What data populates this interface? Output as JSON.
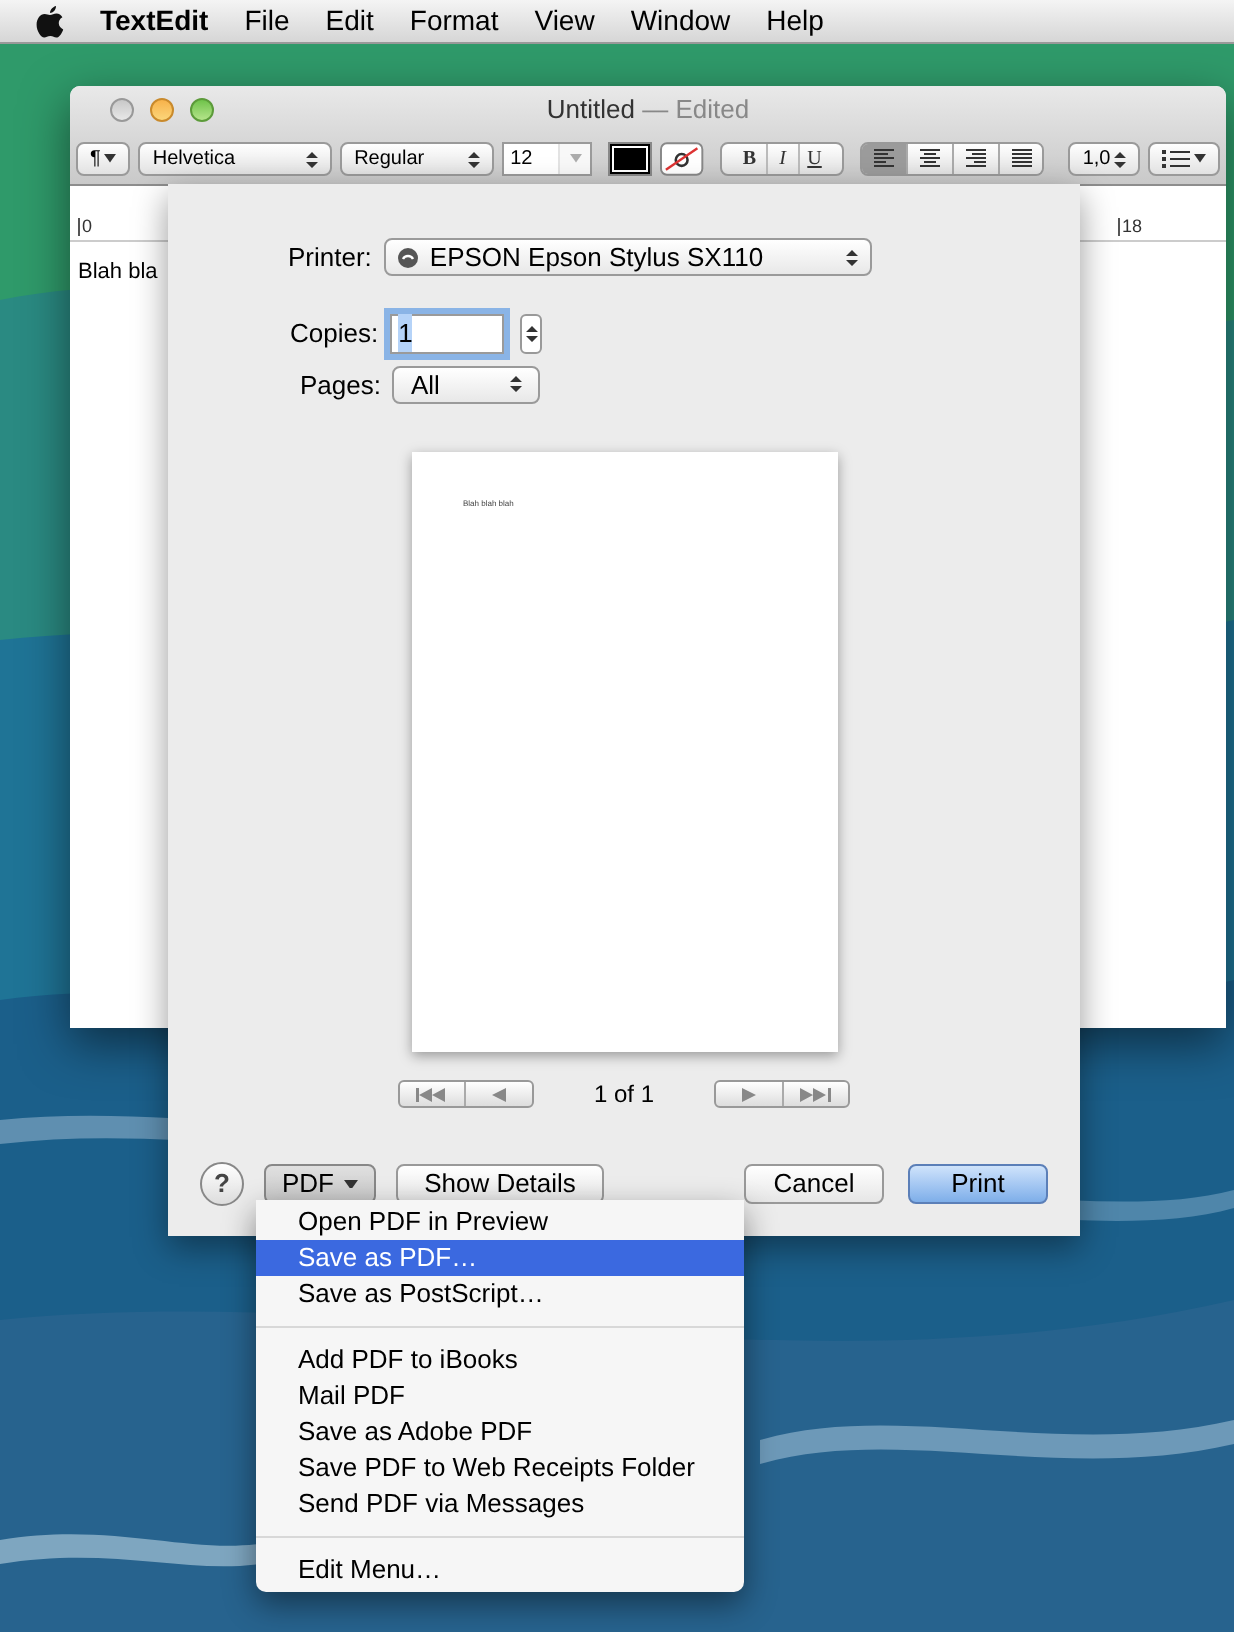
{
  "menu_bar": {
    "app_name": "TextEdit",
    "items": [
      "File",
      "Edit",
      "Format",
      "View",
      "Window",
      "Help"
    ]
  },
  "window": {
    "title": "Untitled",
    "title_suffix": "— Edited",
    "toolbar": {
      "paragraph": "¶",
      "font_family": "Helvetica",
      "font_style": "Regular",
      "font_size": "12",
      "text_styles": [
        "B",
        "I",
        "U"
      ],
      "alignments": [
        {
          "kind": "left",
          "selected": true
        },
        {
          "kind": "center",
          "selected": false
        },
        {
          "kind": "right",
          "selected": false
        },
        {
          "kind": "justify",
          "selected": false
        }
      ],
      "line_spacing": "1,0"
    },
    "ruler": {
      "start": "0",
      "end": "18"
    },
    "document_text": "Blah bla"
  },
  "print_sheet": {
    "printer_label": "Printer:",
    "printer": "EPSON Epson Stylus SX110",
    "copies_label": "Copies:",
    "copies": "1",
    "pages_label": "Pages:",
    "pages": "All",
    "preview_text": "Blah blah blah",
    "page_indicator": "1 of 1",
    "help": "?",
    "pdf_button": "PDF",
    "buttons": [
      {
        "label": "Show Details",
        "default": false
      },
      {
        "label": "Cancel",
        "default": false
      },
      {
        "label": "Print",
        "default": true
      }
    ]
  },
  "pdf_menu": {
    "groups": [
      [
        {
          "label": "Open PDF in Preview",
          "selected": false
        },
        {
          "label": "Save as PDF…",
          "selected": true
        },
        {
          "label": "Save as PostScript…",
          "selected": false
        }
      ],
      [
        {
          "label": "Add PDF to iBooks",
          "selected": false
        },
        {
          "label": "Mail PDF",
          "selected": false
        },
        {
          "label": "Save as Adobe PDF",
          "selected": false
        },
        {
          "label": "Save PDF to Web Receipts Folder",
          "selected": false
        },
        {
          "label": "Send PDF via Messages",
          "selected": false
        }
      ],
      [
        {
          "label": "Edit Menu…",
          "selected": false
        }
      ]
    ]
  }
}
